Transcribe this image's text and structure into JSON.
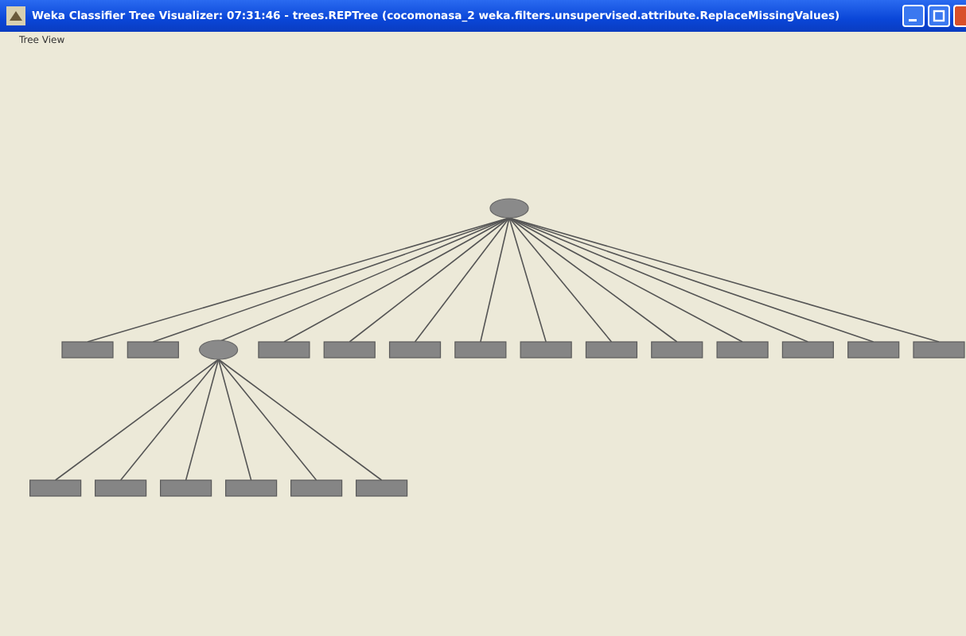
{
  "window": {
    "title": "Weka Classifier Tree Visualizer: 07:31:46 - trees.REPTree (cocomonasa_2 weka.filters.unsupervised.attribute.ReplaceMissingValues)"
  },
  "menu": [
    {
      "label": "Tree View"
    }
  ],
  "tree": {
    "kind": "split",
    "children": [
      {
        "kind": "leaf"
      },
      {
        "kind": "leaf"
      },
      {
        "kind": "split",
        "children": [
          {
            "kind": "leaf"
          },
          {
            "kind": "leaf"
          },
          {
            "kind": "leaf"
          },
          {
            "kind": "leaf"
          },
          {
            "kind": "leaf"
          },
          {
            "kind": "leaf"
          }
        ]
      },
      {
        "kind": "leaf"
      },
      {
        "kind": "leaf"
      },
      {
        "kind": "leaf"
      },
      {
        "kind": "leaf"
      },
      {
        "kind": "leaf"
      },
      {
        "kind": "leaf"
      },
      {
        "kind": "leaf"
      },
      {
        "kind": "leaf"
      },
      {
        "kind": "leaf"
      },
      {
        "kind": "leaf"
      },
      {
        "kind": "leaf"
      }
    ]
  }
}
